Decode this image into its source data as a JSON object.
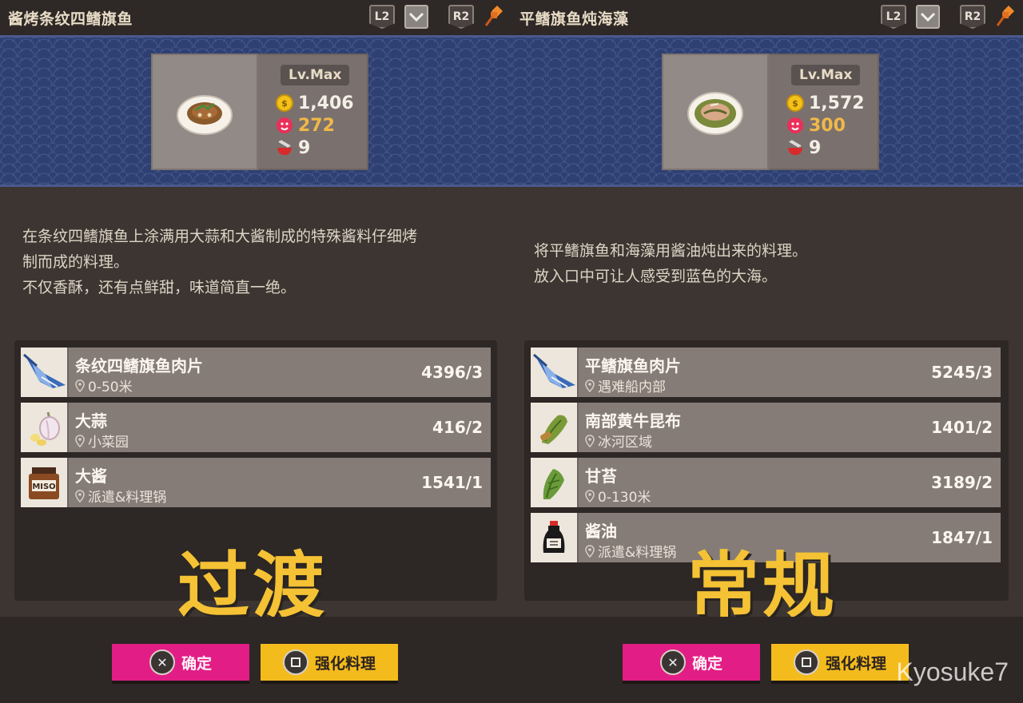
{
  "left": {
    "title": "酱烤条纹四鳍旗鱼",
    "l2": "L2",
    "r2": "R2",
    "level": "Lv.Max",
    "price": "1,406",
    "taste": "272",
    "count": "9",
    "description": [
      "在条纹四鳍旗鱼上涂满用大蒜和大酱制成的特殊酱料仔细烤",
      "制而成的料理。",
      "不仅香酥，还有点鲜甜，味道简直一绝。"
    ],
    "ingredients": [
      {
        "name": "条纹四鳍旗鱼肉片",
        "location": "0-50米",
        "count": "4396/3"
      },
      {
        "name": "大蒜",
        "location": "小菜园",
        "count": "416/2"
      },
      {
        "name": "大酱",
        "location": "派遣&料理锅",
        "count": "1541/1"
      }
    ],
    "overlay": "过渡"
  },
  "right": {
    "title": "平鳍旗鱼炖海藻",
    "l2": "L2",
    "r2": "R2",
    "level": "Lv.Max",
    "price": "1,572",
    "taste": "300",
    "count": "9",
    "description": [
      "将平鳍旗鱼和海藻用酱油炖出来的料理。",
      "放入口中可让人感受到蓝色的大海。"
    ],
    "ingredients": [
      {
        "name": "平鳍旗鱼肉片",
        "location": "遇难船内部",
        "count": "5245/3"
      },
      {
        "name": "南部黄牛昆布",
        "location": "冰河区域",
        "count": "1401/2"
      },
      {
        "name": "甘苔",
        "location": "0-130米",
        "count": "3189/2"
      },
      {
        "name": "酱油",
        "location": "派遣&料理锅",
        "count": "1847/1"
      }
    ],
    "overlay": "常规"
  },
  "buttons": {
    "confirm": "确定",
    "enhance": "强化料理"
  },
  "watermark": "Kyosuke7",
  "colors": {
    "confirm_bg": "#e21d85",
    "enhance_bg": "#f4bb1c",
    "banner_bg": "#2e3f72",
    "overlay_text": "#f4c234"
  }
}
